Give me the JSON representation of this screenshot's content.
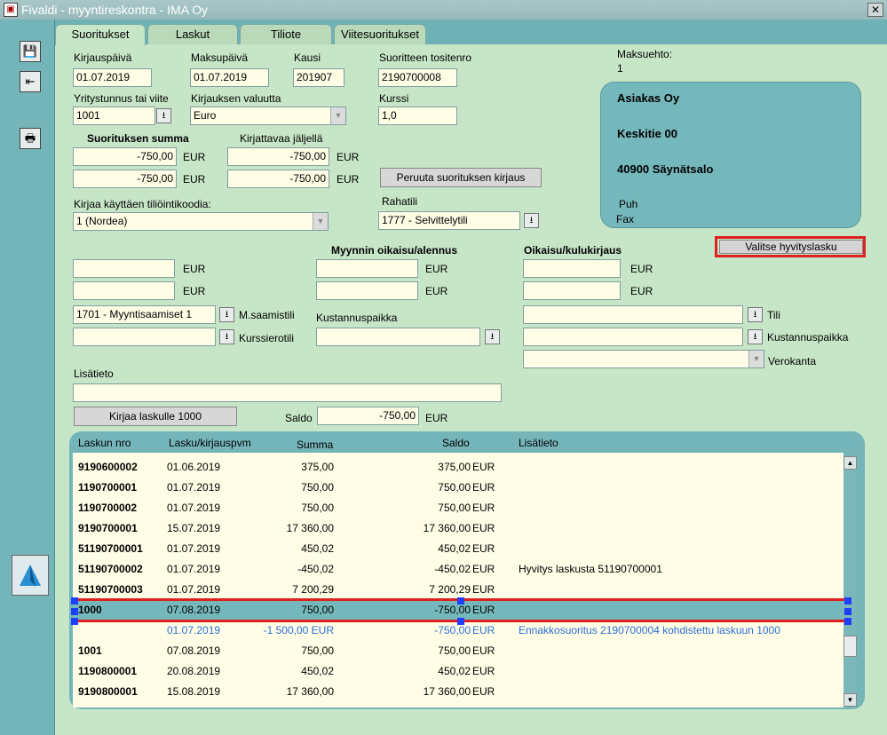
{
  "window": {
    "title": "Fivaldi - myyntireskontra - IMA Oy",
    "close": "✕"
  },
  "tabs": [
    "Suoritukset",
    "Laskut",
    "Tiliote",
    "Viitesuoritukset"
  ],
  "form": {
    "kirjauspaiva_label": "Kirjauspäivä",
    "kirjauspaiva": "01.07.2019",
    "maksupaiva_label": "Maksupäivä",
    "maksupaiva": "01.07.2019",
    "kausi_label": "Kausi",
    "kausi": "201907",
    "tositenro_label": "Suoritteen tositenro",
    "tositenro": "2190700008",
    "maksuehto_label": "Maksuehto:",
    "maksuehto": "1",
    "yritystunnus_label": "Yritystunnus tai viite",
    "yritystunnus": "1001",
    "valuutta_label": "Kirjauksen valuutta",
    "valuutta": "Euro",
    "kurssi_label": "Kurssi",
    "kurssi": "1,0",
    "summa_label": "Suorituksen summa",
    "summa1": "-750,00",
    "summa2": "-750,00",
    "jaljella_label": "Kirjattavaa jäljellä",
    "jaljella1": "-750,00",
    "jaljella2": "-750,00",
    "eur": "EUR",
    "peruuta_button": "Peruuta suorituksen kirjaus",
    "tiliointikoodi_label": "Kirjaa käyttäen tiliöintikoodia:",
    "tiliointikoodi": "1 (Nordea)",
    "rahatili_label": "Rahatili",
    "rahatili": "1777 - Selvittelytili",
    "oikaisu_label": "Myynnin oikaisu/alennus",
    "kulukirjaus_label": "Oikaisu/kulukirjaus",
    "valitse_button": "Valitse hyvityslasku",
    "saamistili_value": "1701 - Myyntisaamiset 1",
    "saamistili_label": "M.saamistili",
    "kurssierotili_label": "Kurssierotili",
    "kustannuspaikka_label": "Kustannuspaikka",
    "tili_label": "Tili",
    "kustannuspaikka2_label": "Kustannuspaikka",
    "verokanta_label": "Verokanta",
    "lisatieto_label": "Lisätieto",
    "kirjaa_button": "Kirjaa laskulle 1000",
    "saldo_label": "Saldo",
    "saldo": "-750,00"
  },
  "customer": {
    "name": "Asiakas Oy",
    "street": "Keskitie 00",
    "city": "40900 Säynätsalo",
    "phone_label": "Puh",
    "fax_label": "Fax"
  },
  "table": {
    "headers": [
      "Laskun nro",
      "Lasku/kirjauspvm",
      "Summa",
      "Saldo",
      "Lisätieto"
    ],
    "rows": [
      {
        "nro": "9190600002",
        "pvm": "01.06.2019",
        "summa": "375,00",
        "saldo": "375,00",
        "cur": "EUR",
        "info": ""
      },
      {
        "nro": "1190700001",
        "pvm": "01.07.2019",
        "summa": "750,00",
        "saldo": "750,00",
        "cur": "EUR",
        "info": ""
      },
      {
        "nro": "1190700002",
        "pvm": "01.07.2019",
        "summa": "750,00",
        "saldo": "750,00",
        "cur": "EUR",
        "info": ""
      },
      {
        "nro": "9190700001",
        "pvm": "15.07.2019",
        "summa": "17 360,00",
        "saldo": "17 360,00",
        "cur": "EUR",
        "info": ""
      },
      {
        "nro": "51190700001",
        "pvm": "01.07.2019",
        "summa": "450,02",
        "saldo": "450,02",
        "cur": "EUR",
        "info": ""
      },
      {
        "nro": "51190700002",
        "pvm": "01.07.2019",
        "summa": "-450,02",
        "saldo": "-450,02",
        "cur": "EUR",
        "info": "Hyvitys laskusta 51190700001"
      },
      {
        "nro": "51190700003",
        "pvm": "01.07.2019",
        "summa": "7 200,29",
        "saldo": "7 200,29",
        "cur": "EUR",
        "info": ""
      },
      {
        "nro": "1000",
        "pvm": "07.08.2019",
        "summa": "750,00",
        "saldo": "-750,00",
        "cur": "EUR",
        "info": ""
      },
      {
        "nro": "",
        "pvm": "01.07.2019",
        "summa": "-1 500,00 EUR",
        "saldo": "-750,00",
        "cur": "EUR",
        "info": "Ennakkosuoritus 2190700004 kohdistettu laskuun 1000"
      },
      {
        "nro": "1001",
        "pvm": "07.08.2019",
        "summa": "750,00",
        "saldo": "750,00",
        "cur": "EUR",
        "info": ""
      },
      {
        "nro": "1190800001",
        "pvm": "20.08.2019",
        "summa": "450,02",
        "saldo": "450,02",
        "cur": "EUR",
        "info": ""
      },
      {
        "nro": "9190800001",
        "pvm": "15.08.2019",
        "summa": "17 360,00",
        "saldo": "17 360,00",
        "cur": "EUR",
        "info": ""
      }
    ]
  },
  "colors": {
    "highlight": "#e02020",
    "selection": "#75b8bc",
    "subrow": "#2a6fd6"
  }
}
